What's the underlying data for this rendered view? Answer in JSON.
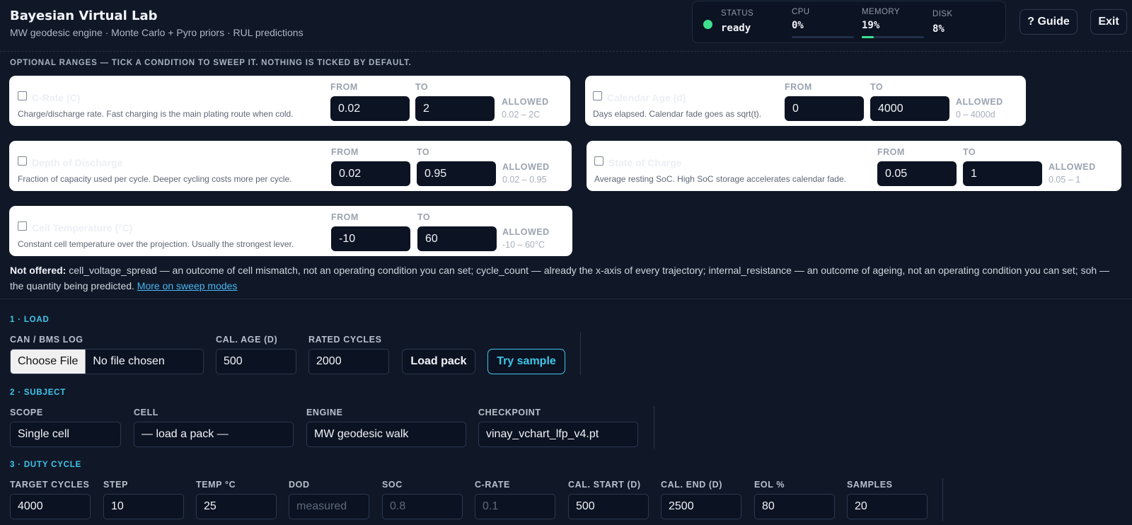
{
  "header": {
    "title": "Bayesian Virtual Lab",
    "subtitle": "MW geodesic engine · Monte Carlo + Pyro priors · RUL predictions",
    "guide_label": "? Guide",
    "exit_label": "Exit"
  },
  "stats": {
    "status_label": "STATUS",
    "status_value": "ready",
    "cpu_label": "CPU",
    "cpu_value": "0%",
    "cpu_fraction": 0.0,
    "memory_label": "MEMORY",
    "memory_value": "19%",
    "memory_fraction": 0.19,
    "disk_label": "DISK",
    "disk_value": "8%",
    "status_color": "#3ee08f"
  },
  "ranges": {
    "note": "OPTIONAL RANGES — TICK A CONDITION TO SWEEP IT. NOTHING IS TICKED BY DEFAULT.",
    "from_label": "FROM",
    "to_label": "TO",
    "allowed_label": "ALLOWED",
    "crate": {
      "title": "C-Rate (C)",
      "desc": "Charge/discharge rate. Fast charging is the main plating route when cold.",
      "from": "0.02",
      "to": "2",
      "allowed": "0.02 – 2C"
    },
    "calendar": {
      "title": "Calendar Age (d)",
      "desc": "Days elapsed. Calendar fade goes as sqrt(t).",
      "from": "0",
      "to": "4000",
      "allowed": "0 – 4000d"
    },
    "dod": {
      "title": "Depth of Discharge",
      "desc": "Fraction of capacity used per cycle. Deeper cycling costs more per cycle.",
      "from": "0.02",
      "to": "0.95",
      "allowed": "0.02 – 0.95"
    },
    "soc": {
      "title": "State of Charge",
      "desc": "Average resting SoC. High SoC storage accelerates calendar fade.",
      "from": "0.05",
      "to": "1",
      "allowed": "0.05 – 1"
    },
    "temp": {
      "title": "Cell Temperature (°C)",
      "desc": "Constant cell temperature over the projection. Usually the strongest lever.",
      "from": "-10",
      "to": "60",
      "allowed": "-10 – 60°C"
    }
  },
  "not_offered": {
    "lead": "Not offered:",
    "text": "cell_voltage_spread — an outcome of cell mismatch, not an operating condition you can set; cycle_count — already the x-axis of every trajectory; internal_resistance — an outcome of ageing, not an operating condition you can set; soh — the quantity being predicted.",
    "link": "More on sweep modes"
  },
  "load": {
    "title": "1 · LOAD",
    "log_label": "CAN / BMS LOG",
    "choose_file": "Choose File",
    "no_file": "No file chosen",
    "cal_age_label": "CAL. AGE (D)",
    "cal_age_value": "500",
    "rated_cycles_label": "RATED CYCLES",
    "rated_cycles_value": "2000",
    "load_pack": "Load pack",
    "try_sample": "Try sample"
  },
  "subject": {
    "title": "2 · SUBJECT",
    "scope_label": "SCOPE",
    "scope_value": "Single cell",
    "cell_label": "CELL",
    "cell_value": "— load a pack —",
    "engine_label": "ENGINE",
    "engine_value": "MW geodesic walk",
    "checkpoint_label": "CHECKPOINT",
    "checkpoint_value": "vinay_vchart_lfp_v4.pt"
  },
  "duty": {
    "title": "3 · DUTY CYCLE",
    "target_label": "TARGET CYCLES",
    "target_value": "4000",
    "step_label": "STEP",
    "step_value": "10",
    "temp_label": "TEMP °C",
    "temp_value": "25",
    "dod_label": "DOD",
    "dod_placeholder": "measured",
    "soc_label": "SOC",
    "soc_placeholder": "0.8",
    "crate_label": "C-RATE",
    "crate_placeholder": "0.1",
    "cal_start_label": "CAL. START (D)",
    "cal_start_value": "500",
    "cal_end_label": "CAL. END (D)",
    "cal_end_value": "2500",
    "eol_label": "EOL %",
    "eol_value": "80",
    "samples_label": "SAMPLES",
    "samples_value": "20"
  }
}
